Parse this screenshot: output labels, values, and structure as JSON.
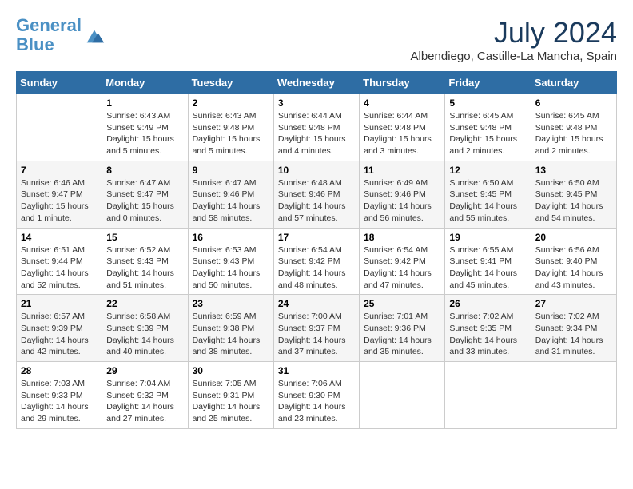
{
  "header": {
    "logo_line1": "General",
    "logo_line2": "Blue",
    "month": "July 2024",
    "location": "Albendiego, Castille-La Mancha, Spain"
  },
  "days_of_week": [
    "Sunday",
    "Monday",
    "Tuesday",
    "Wednesday",
    "Thursday",
    "Friday",
    "Saturday"
  ],
  "weeks": [
    [
      {
        "day": "",
        "info": ""
      },
      {
        "day": "1",
        "info": "Sunrise: 6:43 AM\nSunset: 9:49 PM\nDaylight: 15 hours\nand 5 minutes."
      },
      {
        "day": "2",
        "info": "Sunrise: 6:43 AM\nSunset: 9:48 PM\nDaylight: 15 hours\nand 5 minutes."
      },
      {
        "day": "3",
        "info": "Sunrise: 6:44 AM\nSunset: 9:48 PM\nDaylight: 15 hours\nand 4 minutes."
      },
      {
        "day": "4",
        "info": "Sunrise: 6:44 AM\nSunset: 9:48 PM\nDaylight: 15 hours\nand 3 minutes."
      },
      {
        "day": "5",
        "info": "Sunrise: 6:45 AM\nSunset: 9:48 PM\nDaylight: 15 hours\nand 2 minutes."
      },
      {
        "day": "6",
        "info": "Sunrise: 6:45 AM\nSunset: 9:48 PM\nDaylight: 15 hours\nand 2 minutes."
      }
    ],
    [
      {
        "day": "7",
        "info": "Sunrise: 6:46 AM\nSunset: 9:47 PM\nDaylight: 15 hours\nand 1 minute."
      },
      {
        "day": "8",
        "info": "Sunrise: 6:47 AM\nSunset: 9:47 PM\nDaylight: 15 hours\nand 0 minutes."
      },
      {
        "day": "9",
        "info": "Sunrise: 6:47 AM\nSunset: 9:46 PM\nDaylight: 14 hours\nand 58 minutes."
      },
      {
        "day": "10",
        "info": "Sunrise: 6:48 AM\nSunset: 9:46 PM\nDaylight: 14 hours\nand 57 minutes."
      },
      {
        "day": "11",
        "info": "Sunrise: 6:49 AM\nSunset: 9:46 PM\nDaylight: 14 hours\nand 56 minutes."
      },
      {
        "day": "12",
        "info": "Sunrise: 6:50 AM\nSunset: 9:45 PM\nDaylight: 14 hours\nand 55 minutes."
      },
      {
        "day": "13",
        "info": "Sunrise: 6:50 AM\nSunset: 9:45 PM\nDaylight: 14 hours\nand 54 minutes."
      }
    ],
    [
      {
        "day": "14",
        "info": "Sunrise: 6:51 AM\nSunset: 9:44 PM\nDaylight: 14 hours\nand 52 minutes."
      },
      {
        "day": "15",
        "info": "Sunrise: 6:52 AM\nSunset: 9:43 PM\nDaylight: 14 hours\nand 51 minutes."
      },
      {
        "day": "16",
        "info": "Sunrise: 6:53 AM\nSunset: 9:43 PM\nDaylight: 14 hours\nand 50 minutes."
      },
      {
        "day": "17",
        "info": "Sunrise: 6:54 AM\nSunset: 9:42 PM\nDaylight: 14 hours\nand 48 minutes."
      },
      {
        "day": "18",
        "info": "Sunrise: 6:54 AM\nSunset: 9:42 PM\nDaylight: 14 hours\nand 47 minutes."
      },
      {
        "day": "19",
        "info": "Sunrise: 6:55 AM\nSunset: 9:41 PM\nDaylight: 14 hours\nand 45 minutes."
      },
      {
        "day": "20",
        "info": "Sunrise: 6:56 AM\nSunset: 9:40 PM\nDaylight: 14 hours\nand 43 minutes."
      }
    ],
    [
      {
        "day": "21",
        "info": "Sunrise: 6:57 AM\nSunset: 9:39 PM\nDaylight: 14 hours\nand 42 minutes."
      },
      {
        "day": "22",
        "info": "Sunrise: 6:58 AM\nSunset: 9:39 PM\nDaylight: 14 hours\nand 40 minutes."
      },
      {
        "day": "23",
        "info": "Sunrise: 6:59 AM\nSunset: 9:38 PM\nDaylight: 14 hours\nand 38 minutes."
      },
      {
        "day": "24",
        "info": "Sunrise: 7:00 AM\nSunset: 9:37 PM\nDaylight: 14 hours\nand 37 minutes."
      },
      {
        "day": "25",
        "info": "Sunrise: 7:01 AM\nSunset: 9:36 PM\nDaylight: 14 hours\nand 35 minutes."
      },
      {
        "day": "26",
        "info": "Sunrise: 7:02 AM\nSunset: 9:35 PM\nDaylight: 14 hours\nand 33 minutes."
      },
      {
        "day": "27",
        "info": "Sunrise: 7:02 AM\nSunset: 9:34 PM\nDaylight: 14 hours\nand 31 minutes."
      }
    ],
    [
      {
        "day": "28",
        "info": "Sunrise: 7:03 AM\nSunset: 9:33 PM\nDaylight: 14 hours\nand 29 minutes."
      },
      {
        "day": "29",
        "info": "Sunrise: 7:04 AM\nSunset: 9:32 PM\nDaylight: 14 hours\nand 27 minutes."
      },
      {
        "day": "30",
        "info": "Sunrise: 7:05 AM\nSunset: 9:31 PM\nDaylight: 14 hours\nand 25 minutes."
      },
      {
        "day": "31",
        "info": "Sunrise: 7:06 AM\nSunset: 9:30 PM\nDaylight: 14 hours\nand 23 minutes."
      },
      {
        "day": "",
        "info": ""
      },
      {
        "day": "",
        "info": ""
      },
      {
        "day": "",
        "info": ""
      }
    ]
  ]
}
